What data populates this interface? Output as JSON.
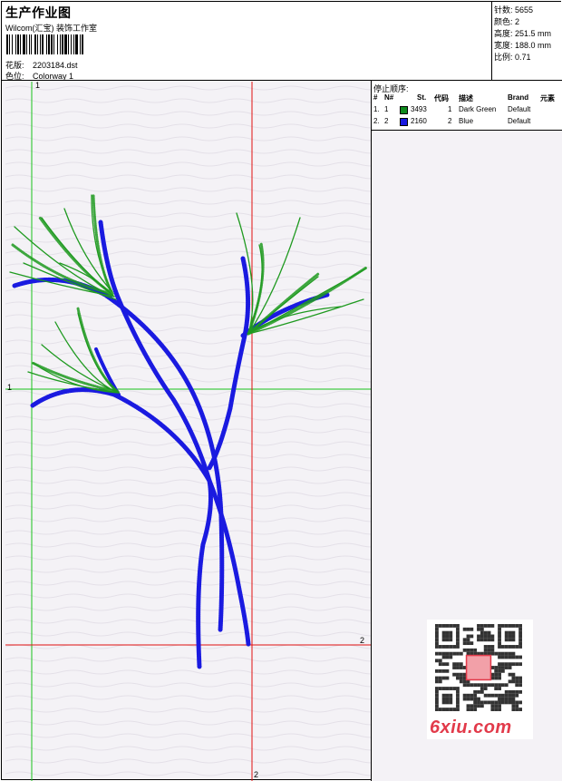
{
  "header": {
    "title": "生产作业图",
    "studio": "Wilcom(汇宝) 装饰工作室",
    "design_label": "花版:",
    "design_file": "2203184.dst",
    "colorway_label": "色位:",
    "colorway": "Colorway 1"
  },
  "stats": {
    "stitches_label": "针数:",
    "stitches": "5655",
    "colors_label": "颜色:",
    "colors": "2",
    "height_label": "高度:",
    "height": "251.5 mm",
    "width_label": "宽度:",
    "width": "188.0 mm",
    "scale_label": "比例:",
    "scale": "0.71"
  },
  "stop_sequence": {
    "title": "停止顺序:",
    "columns": [
      "#",
      "N#",
      "St.",
      "代码",
      "描述",
      "Brand",
      "元素"
    ],
    "rows": [
      {
        "index": "1.",
        "no": "1",
        "color": "#0f8a1d",
        "stitches": "3493",
        "code": "1",
        "description": "Dark Green",
        "brand": "Default"
      },
      {
        "index": "2.",
        "no": "2",
        "color": "#1818e0",
        "stitches": "2160",
        "code": "2",
        "description": "Blue",
        "brand": "Default"
      }
    ]
  },
  "guides": {
    "top_1": "1",
    "left_1": "1",
    "right_2": "2",
    "bottom_2": "2"
  },
  "colors": {
    "green_guide": "#19c219",
    "red_guide": "#e01010",
    "thread_green": "#1f9a20",
    "thread_blue": "#1a1ae0"
  },
  "watermark": {
    "text": "6xiu.com"
  }
}
